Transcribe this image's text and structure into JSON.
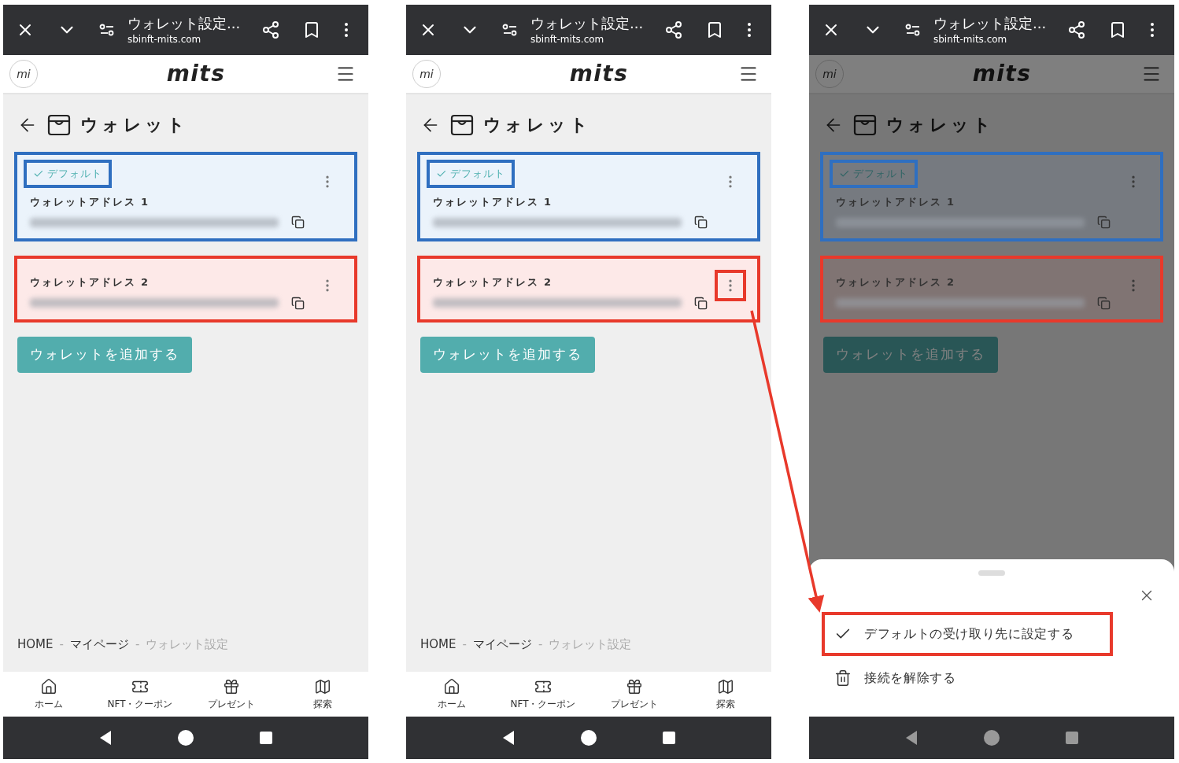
{
  "phones": [
    {
      "browser": {
        "title": "ウォレット設定...",
        "url": "sbinft-mits.com"
      },
      "avatar": "mi",
      "logo": "mits",
      "page_title": "ウォレット",
      "dimmed": false,
      "wallets": [
        {
          "name": "ウォレットアドレス 1",
          "is_default": true,
          "default_label": "デフォルト",
          "color": "#2f6fc0",
          "menu_outlined": false
        },
        {
          "name": "ウォレットアドレス 2",
          "is_default": false,
          "color": "#e8392b",
          "menu_outlined": false
        }
      ],
      "add_button": "ウォレットを追加する",
      "breadcrumb": [
        {
          "label": "HOME",
          "current": false
        },
        {
          "separator": "-",
          "label": "マイページ",
          "current": false
        },
        {
          "separator": "-",
          "label": "ウォレット設定",
          "current": true
        }
      ],
      "nav": [
        {
          "kind": "home",
          "label": "ホーム"
        },
        {
          "kind": "ticket",
          "label": "NFT・クーポン"
        },
        {
          "kind": "gift",
          "label": "プレゼント"
        },
        {
          "kind": "map",
          "label": "探索"
        }
      ]
    },
    {
      "browser": {
        "title": "ウォレット設定...",
        "url": "sbinft-mits.com"
      },
      "avatar": "mi",
      "logo": "mits",
      "page_title": "ウォレット",
      "dimmed": false,
      "wallets": [
        {
          "name": "ウォレットアドレス 1",
          "is_default": true,
          "default_label": "デフォルト",
          "color": "#2f6fc0",
          "menu_outlined": false
        },
        {
          "name": "ウォレットアドレス 2",
          "is_default": false,
          "color": "#e8392b",
          "menu_outlined": true
        }
      ],
      "add_button": "ウォレットを追加する",
      "breadcrumb": [
        {
          "label": "HOME",
          "current": false
        },
        {
          "separator": "-",
          "label": "マイページ",
          "current": false
        },
        {
          "separator": "-",
          "label": "ウォレット設定",
          "current": true
        }
      ],
      "nav": [
        {
          "kind": "home",
          "label": "ホーム"
        },
        {
          "kind": "ticket",
          "label": "NFT・クーポン"
        },
        {
          "kind": "gift",
          "label": "プレゼント"
        },
        {
          "kind": "map",
          "label": "探索"
        }
      ]
    },
    {
      "browser": {
        "title": "ウォレット設定...",
        "url": "sbinft-mits.com"
      },
      "avatar": "mi",
      "logo": "mits",
      "page_title": "ウォレット",
      "dimmed": true,
      "wallets": [
        {
          "name": "ウォレットアドレス 1",
          "is_default": true,
          "default_label": "デフォルト",
          "color": "#2f6fc0",
          "menu_outlined": false
        },
        {
          "name": "ウォレットアドレス 2",
          "is_default": false,
          "color": "#e8392b",
          "menu_outlined": false
        }
      ],
      "add_button": "ウォレットを追加する",
      "sheet": {
        "items": [
          {
            "kind": "check",
            "label": "デフォルトの受け取り先に設定する",
            "outlined": true
          },
          {
            "kind": "trash",
            "label": "接続を解除する",
            "outlined": false
          }
        ]
      }
    }
  ],
  "arrow": {
    "color": "#e8392b"
  }
}
